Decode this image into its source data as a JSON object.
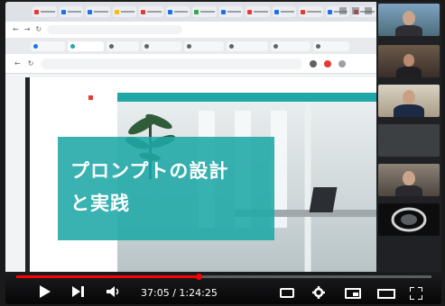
{
  "browser": {
    "top_tabs": [
      {
        "favicon_color": "#e53935"
      },
      {
        "favicon_color": "#1a73e8"
      },
      {
        "favicon_color": "#1a73e8"
      },
      {
        "favicon_color": "#fbbc04"
      },
      {
        "favicon_color": "#e53935"
      },
      {
        "favicon_color": "#1a73e8"
      },
      {
        "favicon_color": "#34a853"
      },
      {
        "favicon_color": "#1a73e8"
      },
      {
        "favicon_color": "#e53935"
      },
      {
        "favicon_color": "#1a73e8"
      },
      {
        "favicon_color": "#e53935"
      },
      {
        "favicon_color": "#1a73e8"
      },
      {
        "favicon_color": "#e53935"
      }
    ],
    "address1": "",
    "second_tabs": [
      {
        "label": "",
        "favicon_color": "#1a73e8"
      },
      {
        "label": "",
        "favicon_color": "#1fa7a7",
        "active": true
      },
      {
        "label": "",
        "favicon_color": "#5f6368"
      },
      {
        "label": "",
        "favicon_color": "#5f6368"
      },
      {
        "label": "",
        "favicon_color": "#5f6368"
      },
      {
        "label": "",
        "favicon_color": "#5f6368"
      },
      {
        "label": "",
        "favicon_color": "#5f6368"
      },
      {
        "label": "",
        "favicon_color": "#5f6368"
      }
    ],
    "address2": ""
  },
  "slide": {
    "title_line1": "プロンプトの設計",
    "title_line2": "と実践",
    "accent_color": "#1fa7a7"
  },
  "participants": [
    {
      "label": ""
    },
    {
      "label": ""
    },
    {
      "label": ""
    },
    {
      "label": ""
    },
    {
      "label": ""
    },
    {
      "label": ""
    }
  ],
  "player": {
    "current_time": "37:05",
    "separator": " / ",
    "duration": "1:24:25",
    "progress_fraction": 0.439,
    "progress_color": "#ff0000"
  }
}
